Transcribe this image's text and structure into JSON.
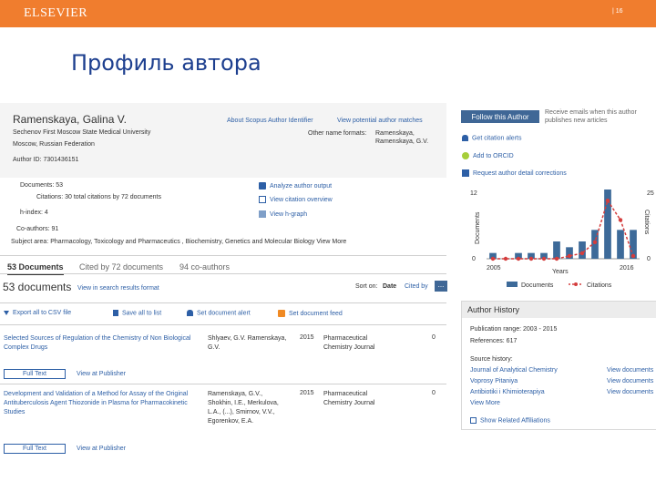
{
  "header": {
    "brand": "ELSEVIER",
    "page_number": "| 16"
  },
  "slide_title": "Профиль автора",
  "author": {
    "name": "Ramenskaya, Galina V.",
    "affiliation_line1": "Sechenov First Moscow State Medical University",
    "affiliation_line2": "Moscow, Russian Federation",
    "author_id": "Author ID: 7301436151",
    "about_link": "About Scopus Author Identifier",
    "matches_link": "View potential author matches",
    "other_formats_label": "Other name formats:",
    "other_format_1": "Ramenskaya,",
    "other_format_2": "Ramenskaya, G.V."
  },
  "metrics": {
    "documents": "Documents: 53",
    "citations": "Citations: 30 total citations by 72 documents",
    "hindex": "h-index: 4",
    "coauthors": "Co-authors: 91",
    "subjects": "Subject area: Pharmacology, Toxicology and Pharmaceutics , Biochemistry, Genetics and Molecular Biology View More",
    "analyze_link": "Analyze author output",
    "citation_overview_link": "View citation overview",
    "hgraph_link": "View h-graph"
  },
  "tabs": {
    "documents": "53 Documents",
    "cited_by": "Cited by 72 documents",
    "coauthors": "94 co-authors"
  },
  "results": {
    "count": "53 documents",
    "view_in_search": "View in search results format",
    "sort_on_label": "Sort on:",
    "sort_date": "Date",
    "sort_cited": "Cited by",
    "sort_more": "...",
    "export_csv": "Export all to CSV file",
    "save_list": "Save all to list",
    "set_alert": "Set document alert",
    "set_feed": "Set document feed"
  },
  "documents": [
    {
      "title": "Selected Sources of Regulation of the Chemistry of Non Biological Complex Drugs",
      "authors": "Shlyaev, G.V. Ramenskaya, G.V.",
      "year": "2015",
      "source": "Pharmaceutical Chemistry Journal",
      "cited": "0",
      "full_text": "Full Text",
      "publisher": "View at Publisher"
    },
    {
      "title": "Development and Validation of a Method for Assay of the Original Antituberculosis Agent Thiozonide in Plasma for Pharmacokinetic Studies",
      "authors": "Ramenskaya, G.V., Shokhin, I.E., Merkulova, L.A., (...), Smirnov, V.V., Egorenkov, E.A.",
      "year": "2015",
      "source": "Pharmaceutical Chemistry Journal",
      "cited": "0",
      "full_text": "Full Text",
      "publisher": "View at Publisher"
    }
  ],
  "sidebar": {
    "follow_button": "Follow this Author",
    "follow_note": "Receive emails when this author publishes new articles",
    "citation_alert": "Get citation alerts",
    "orcid": "Add to ORCID",
    "request_corrections": "Request author detail corrections"
  },
  "chart_data": {
    "type": "bar",
    "xlabel": "Years",
    "ylabel_left": "Documents",
    "ylabel_right": "Citations",
    "x_tick_start": "2005",
    "x_tick_end": "2016",
    "left_ticks": [
      "12",
      "0"
    ],
    "right_ticks": [
      "25",
      "0"
    ],
    "ylim_left": [
      0,
      12
    ],
    "ylim_right": [
      0,
      25
    ],
    "legend_documents": "Documents",
    "legend_citations": "Citations",
    "colors": {
      "documents": "#3d6a99",
      "citations": "#d43d3d"
    },
    "documents": [
      1,
      0,
      1,
      1,
      1,
      3,
      2,
      3,
      5,
      12,
      5,
      5
    ],
    "citations": [
      0,
      0,
      0,
      0,
      0,
      0,
      1,
      2,
      6,
      21,
      14,
      1
    ]
  },
  "history": {
    "header": "Author History",
    "pub_range": "Publication range: 2003 - 2015",
    "references": "References: 617",
    "source_label": "Source history:",
    "sources": [
      {
        "name": "Journal of Analytical Chemistry",
        "action": "View documents"
      },
      {
        "name": "Voprosy Pitaniya",
        "action": "View documents"
      },
      {
        "name": "Antibiotiki i Khimioterapiya",
        "action": "View documents"
      }
    ],
    "view_more": "View More",
    "related": "Show Related Affiliations"
  }
}
